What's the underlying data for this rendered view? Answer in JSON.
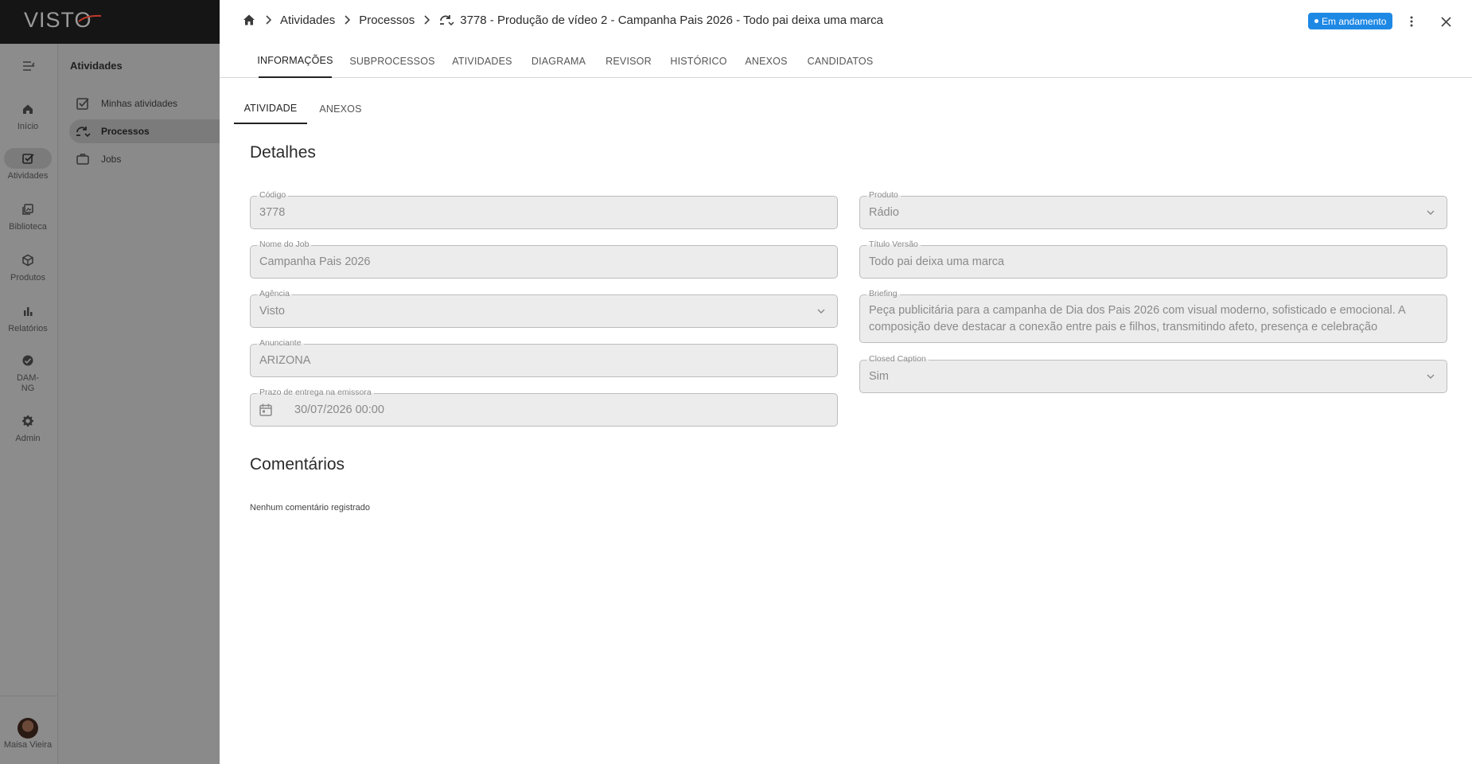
{
  "app": {
    "logo": "VISTO"
  },
  "rail": {
    "items": [
      {
        "label": "Início",
        "icon": "home-icon"
      },
      {
        "label": "Atividades",
        "icon": "checkbox-icon"
      },
      {
        "label": "Biblioteca",
        "icon": "library-icon"
      },
      {
        "label": "Produtos",
        "icon": "cube-icon"
      },
      {
        "label": "Relatórios",
        "icon": "bar-chart-icon"
      },
      {
        "label": "DAM-NG",
        "icon": "dam-icon"
      },
      {
        "label": "Admin",
        "icon": "gear-icon"
      }
    ],
    "user": {
      "name": "Maisa Vieira"
    }
  },
  "subnav": {
    "title": "Atividades",
    "items": [
      {
        "label": "Minhas atividades",
        "icon": "checkbox-icon"
      },
      {
        "label": "Processos",
        "icon": "process-icon"
      },
      {
        "label": "Jobs",
        "icon": "briefcase-icon"
      }
    ]
  },
  "header": {
    "breadcrumb": [
      "Atividades",
      "Processos"
    ],
    "current": "3778 - Produção de vídeo 2 - Campanha Pais 2026 - Todo pai deixa uma marca",
    "status": "Em andamento",
    "status_color": "#1e88e5"
  },
  "tabs": [
    "INFORMAÇÕES",
    "SUBPROCESSOS",
    "ATIVIDADES",
    "DIAGRAMA",
    "REVISOR",
    "HISTÓRICO",
    "ANEXOS",
    "CANDIDATOS"
  ],
  "subtabs": [
    "ATIVIDADE",
    "ANEXOS"
  ],
  "details": {
    "title": "Detalhes",
    "codigo": {
      "label": "Código",
      "value": "3778"
    },
    "nome_job": {
      "label": "Nome do Job",
      "value": "Campanha Pais 2026"
    },
    "agencia": {
      "label": "Agência",
      "value": "Visto"
    },
    "anunciante": {
      "label": "Anunciante",
      "value": "ARIZONA"
    },
    "prazo": {
      "label": "Prazo de entrega na emissora",
      "value": "30/07/2026 00:00"
    },
    "produto": {
      "label": "Produto",
      "value": "Rádio"
    },
    "titulo_versao": {
      "label": "Título Versão",
      "value": "Todo pai deixa uma marca"
    },
    "briefing": {
      "label": "Briefing",
      "value": "Peça publicitária para a campanha de Dia dos Pais 2026 com visual moderno, sofisticado e emocional. A composição deve destacar a conexão entre pais e filhos, transmitindo afeto, presença e celebração"
    },
    "closed_caption": {
      "label": "Closed Caption",
      "value": "Sim"
    }
  },
  "comments": {
    "title": "Comentários",
    "empty": "Nenhum comentário registrado"
  }
}
